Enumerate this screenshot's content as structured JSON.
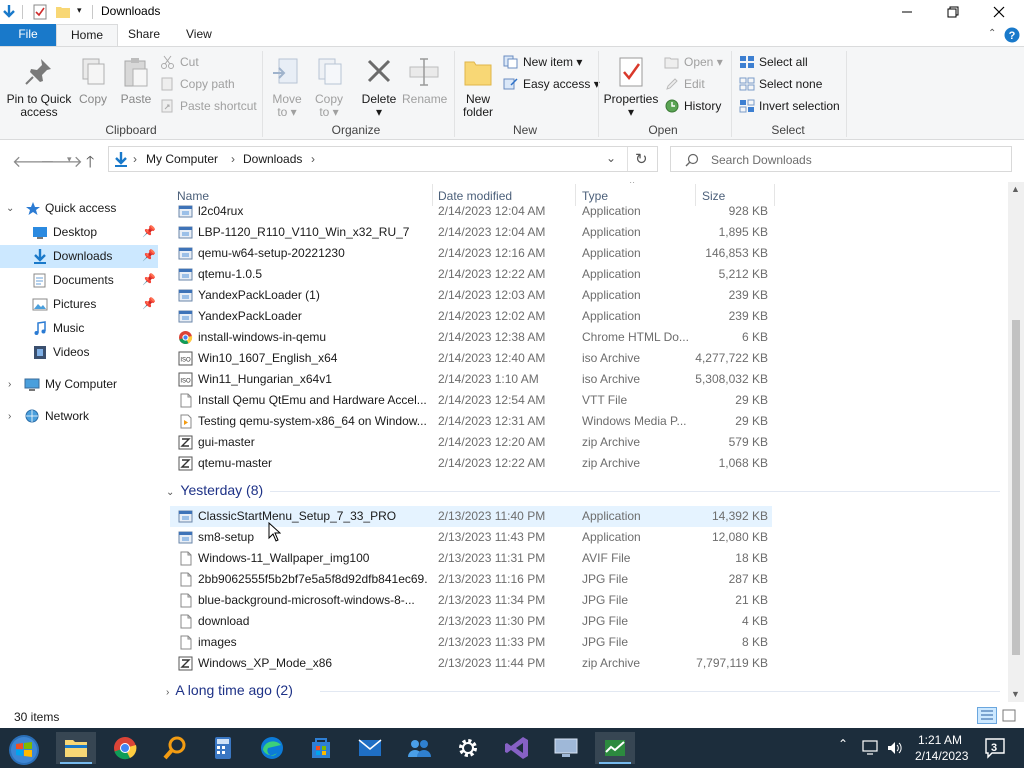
{
  "window": {
    "title": "Downloads"
  },
  "ribbon": {
    "tabs": [
      {
        "label": "File"
      },
      {
        "label": "Home"
      },
      {
        "label": "Share"
      },
      {
        "label": "View"
      }
    ],
    "clipboard": {
      "pin_label_1": "Pin to Quick",
      "pin_label_2": "access",
      "copy": "Copy",
      "paste": "Paste",
      "cut": "Cut",
      "copy_path": "Copy path",
      "paste_shortcut": "Paste shortcut",
      "group": "Clipboard"
    },
    "organize": {
      "move_to_1": "Move",
      "move_to_2": "to",
      "copy_to_1": "Copy",
      "copy_to_2": "to",
      "delete": "Delete",
      "rename": "Rename",
      "group": "Organize"
    },
    "new": {
      "new_folder_1": "New",
      "new_folder_2": "folder",
      "new_item": "New item",
      "easy_access": "Easy access",
      "group": "New"
    },
    "open": {
      "properties": "Properties",
      "open": "Open",
      "edit": "Edit",
      "history": "History",
      "group": "Open"
    },
    "select": {
      "select_all": "Select all",
      "select_none": "Select none",
      "invert": "Invert selection",
      "group": "Select"
    }
  },
  "address": {
    "crumbs": [
      "My Computer",
      "Downloads"
    ],
    "search_placeholder": "Search Downloads"
  },
  "nav": {
    "items": [
      {
        "label": "Quick access"
      },
      {
        "label": "Desktop"
      },
      {
        "label": "Downloads"
      },
      {
        "label": "Documents"
      },
      {
        "label": "Pictures"
      },
      {
        "label": "Music"
      },
      {
        "label": "Videos"
      },
      {
        "label": "My Computer"
      },
      {
        "label": "Network"
      }
    ]
  },
  "columns": {
    "name": "Name",
    "date": "Date modified",
    "type": "Type",
    "size": "Size"
  },
  "files_today": [
    {
      "name": "l2c04rux",
      "date": "2/14/2023 12:04 AM",
      "type": "Application",
      "size": "928 KB"
    },
    {
      "name": "LBP-1120_R110_V110_Win_x32_RU_7",
      "date": "2/14/2023 12:04 AM",
      "type": "Application",
      "size": "1,895 KB"
    },
    {
      "name": "qemu-w64-setup-20221230",
      "date": "2/14/2023 12:16 AM",
      "type": "Application",
      "size": "146,853 KB"
    },
    {
      "name": "qtemu-1.0.5",
      "date": "2/14/2023 12:22 AM",
      "type": "Application",
      "size": "5,212 KB"
    },
    {
      "name": "YandexPackLoader (1)",
      "date": "2/14/2023 12:03 AM",
      "type": "Application",
      "size": "239 KB"
    },
    {
      "name": "YandexPackLoader",
      "date": "2/14/2023 12:02 AM",
      "type": "Application",
      "size": "239 KB"
    },
    {
      "name": "install-windows-in-qemu",
      "date": "2/14/2023 12:38 AM",
      "type": "Chrome HTML Do...",
      "size": "6 KB"
    },
    {
      "name": "Win10_1607_English_x64",
      "date": "2/14/2023 12:40 AM",
      "type": "iso Archive",
      "size": "4,277,722 KB"
    },
    {
      "name": "Win11_Hungarian_x64v1",
      "date": "2/14/2023 1:10 AM",
      "type": "iso Archive",
      "size": "5,308,032 KB"
    },
    {
      "name": "Install Qemu QtEmu and Hardware Accel...",
      "date": "2/14/2023 12:54 AM",
      "type": "VTT File",
      "size": "29 KB"
    },
    {
      "name": "Testing qemu-system-x86_64 on Window...",
      "date": "2/14/2023 12:31 AM",
      "type": "Windows Media P...",
      "size": "29 KB"
    },
    {
      "name": "gui-master",
      "date": "2/14/2023 12:20 AM",
      "type": "zip Archive",
      "size": "579 KB"
    },
    {
      "name": "qtemu-master",
      "date": "2/14/2023 12:22 AM",
      "type": "zip Archive",
      "size": "1,068 KB"
    }
  ],
  "group_yesterday": "Yesterday (8)",
  "files_yesterday": [
    {
      "name": "ClassicStartMenu_Setup_7_33_PRO",
      "date": "2/13/2023 11:40 PM",
      "type": "Application",
      "size": "14,392 KB"
    },
    {
      "name": "sm8-setup",
      "date": "2/13/2023 11:43 PM",
      "type": "Application",
      "size": "12,080 KB"
    },
    {
      "name": "Windows-11_Wallpaper_img100",
      "date": "2/13/2023 11:31 PM",
      "type": "AVIF File",
      "size": "18 KB"
    },
    {
      "name": "2bb9062555f5b2bf7e5a5f8d92dfb841ec69...",
      "date": "2/13/2023 11:16 PM",
      "type": "JPG File",
      "size": "287 KB"
    },
    {
      "name": "blue-background-microsoft-windows-8-...",
      "date": "2/13/2023 11:34 PM",
      "type": "JPG File",
      "size": "21 KB"
    },
    {
      "name": "download",
      "date": "2/13/2023 11:30 PM",
      "type": "JPG File",
      "size": "4 KB"
    },
    {
      "name": "images",
      "date": "2/13/2023 11:33 PM",
      "type": "JPG File",
      "size": "8 KB"
    },
    {
      "name": "Windows_XP_Mode_x86",
      "date": "2/13/2023 11:44 PM",
      "type": "zip Archive",
      "size": "7,797,119 KB"
    }
  ],
  "group_long_ago": "A long time ago (2)",
  "status": {
    "items": "30 items"
  },
  "taskbar": {
    "time": "1:21 AM",
    "date": "2/14/2023",
    "notifications": "3"
  },
  "colors": {
    "accent": "#1979ca",
    "selection": "#cce8ff",
    "hover": "#e5f3ff",
    "taskbar": "#1c2d3c",
    "group_header": "#1e3287"
  }
}
